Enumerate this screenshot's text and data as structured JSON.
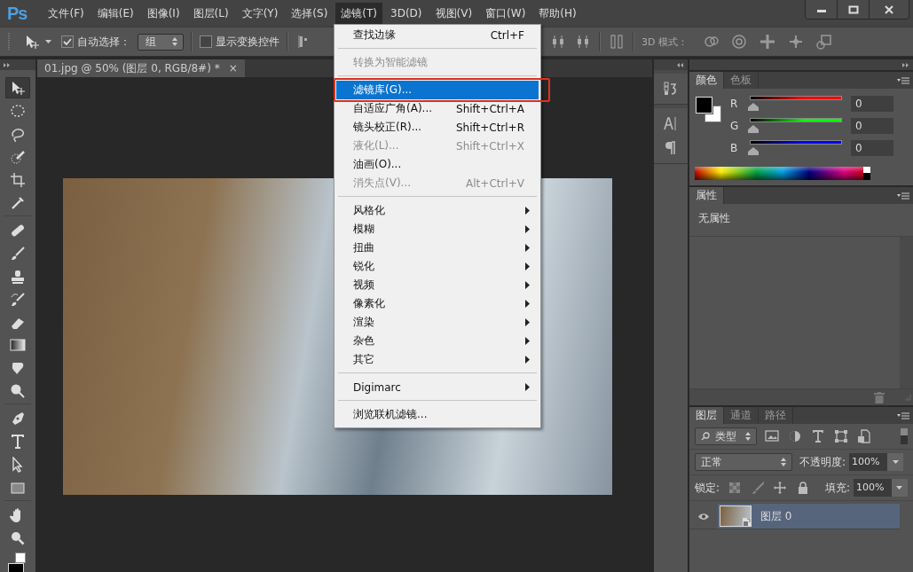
{
  "app_logo": "Ps",
  "menubar": [
    {
      "label": "文件(F)",
      "selected": false
    },
    {
      "label": "编辑(E)",
      "selected": false
    },
    {
      "label": "图像(I)",
      "selected": false
    },
    {
      "label": "图层(L)",
      "selected": false
    },
    {
      "label": "文字(Y)",
      "selected": false
    },
    {
      "label": "选择(S)",
      "selected": false
    },
    {
      "label": "滤镜(T)",
      "selected": true
    },
    {
      "label": "3D(D)",
      "selected": false
    },
    {
      "label": "视图(V)",
      "selected": false
    },
    {
      "label": "窗口(W)",
      "selected": false
    },
    {
      "label": "帮助(H)",
      "selected": false
    }
  ],
  "options_bar": {
    "auto_select": {
      "label": "自动选择：",
      "checked": true
    },
    "auto_select_target": "组",
    "show_transform": {
      "label": "显示变换控件",
      "checked": false
    },
    "mode_label": "3D 模式："
  },
  "document_tab": {
    "title": "01.jpg @ 50% (图层 0, RGB/8#) *",
    "close": "×"
  },
  "tools": [
    {
      "kind": "move",
      "selected": true
    },
    {
      "kind": "marquee",
      "selected": false
    },
    {
      "kind": "lasso",
      "selected": false
    },
    {
      "kind": "quick",
      "selected": false
    },
    {
      "kind": "crop",
      "selected": false
    },
    {
      "kind": "eyedropper",
      "selected": false
    },
    {
      "kind": "sep"
    },
    {
      "kind": "healing",
      "selected": false
    },
    {
      "kind": "brush",
      "selected": false
    },
    {
      "kind": "stamp",
      "selected": false
    },
    {
      "kind": "history",
      "selected": false
    },
    {
      "kind": "eraser",
      "selected": false
    },
    {
      "kind": "gradient",
      "selected": false
    },
    {
      "kind": "blur",
      "selected": false
    },
    {
      "kind": "dodge",
      "selected": false
    },
    {
      "kind": "sep"
    },
    {
      "kind": "pen",
      "selected": false
    },
    {
      "kind": "type",
      "selected": false
    },
    {
      "kind": "path",
      "selected": false
    },
    {
      "kind": "shape",
      "selected": false
    },
    {
      "kind": "sep"
    },
    {
      "kind": "hand",
      "selected": false
    },
    {
      "kind": "zoom",
      "selected": false
    }
  ],
  "filter_menu": [
    {
      "kind": "item",
      "label": "查找边缘",
      "shortcut": "Ctrl+F",
      "disabled": false,
      "selected": false
    },
    {
      "kind": "separator"
    },
    {
      "kind": "item",
      "label": "转换为智能滤镜",
      "disabled": true,
      "selected": false
    },
    {
      "kind": "separator"
    },
    {
      "kind": "item",
      "label": "滤镜库(G)...",
      "disabled": false,
      "selected": true,
      "outlined": true
    },
    {
      "kind": "item",
      "label": "自适应广角(A)...",
      "shortcut": "Shift+Ctrl+A",
      "disabled": false,
      "selected": false
    },
    {
      "kind": "item",
      "label": "镜头校正(R)...",
      "shortcut": "Shift+Ctrl+R",
      "disabled": false,
      "selected": false
    },
    {
      "kind": "item",
      "label": "液化(L)...",
      "shortcut": "Shift+Ctrl+X",
      "disabled": true,
      "selected": false
    },
    {
      "kind": "item",
      "label": "油画(O)...",
      "disabled": false,
      "selected": false
    },
    {
      "kind": "item",
      "label": "消失点(V)...",
      "shortcut": "Alt+Ctrl+V",
      "disabled": true,
      "selected": false
    },
    {
      "kind": "separator"
    },
    {
      "kind": "item",
      "label": "风格化",
      "submenu": true,
      "disabled": false,
      "selected": false
    },
    {
      "kind": "item",
      "label": "模糊",
      "submenu": true,
      "disabled": false,
      "selected": false
    },
    {
      "kind": "item",
      "label": "扭曲",
      "submenu": true,
      "disabled": false,
      "selected": false
    },
    {
      "kind": "item",
      "label": "锐化",
      "submenu": true,
      "disabled": false,
      "selected": false
    },
    {
      "kind": "item",
      "label": "视频",
      "submenu": true,
      "disabled": false,
      "selected": false
    },
    {
      "kind": "item",
      "label": "像素化",
      "submenu": true,
      "disabled": false,
      "selected": false
    },
    {
      "kind": "item",
      "label": "渲染",
      "submenu": true,
      "disabled": false,
      "selected": false
    },
    {
      "kind": "item",
      "label": "杂色",
      "submenu": true,
      "disabled": false,
      "selected": false
    },
    {
      "kind": "item",
      "label": "其它",
      "submenu": true,
      "disabled": false,
      "selected": false
    },
    {
      "kind": "separator"
    },
    {
      "kind": "item",
      "label": "Digimarc",
      "submenu": true,
      "disabled": false,
      "selected": false
    },
    {
      "kind": "separator"
    },
    {
      "kind": "item",
      "label": "浏览联机滤镜...",
      "disabled": false,
      "selected": false
    }
  ],
  "color_panel": {
    "tabs": [
      {
        "label": "颜色",
        "selected": true
      },
      {
        "label": "色板",
        "selected": false
      }
    ],
    "channels": [
      {
        "label": "R",
        "color": "#ff0000",
        "level": 0,
        "value": "0"
      },
      {
        "label": "G",
        "color": "#00ff00",
        "level": 0,
        "value": "0"
      },
      {
        "label": "B",
        "color": "#0000ff",
        "level": 0,
        "value": "0"
      }
    ]
  },
  "properties_panel": {
    "tabs": [
      {
        "label": "属性",
        "selected": true
      }
    ],
    "text": "无属性"
  },
  "layers_panel": {
    "tabs": [
      {
        "label": "图层",
        "selected": true
      },
      {
        "label": "通道",
        "selected": false
      },
      {
        "label": "路径",
        "selected": false
      }
    ],
    "filter": "类型",
    "blend_mode": "正常",
    "opacity_label": "不透明度:",
    "opacity": "100%",
    "lock_label": "锁定:",
    "fill_label": "填充:",
    "fill": "100%",
    "layers": [
      {
        "name": "图层 0",
        "visible": true,
        "selected": true
      }
    ]
  }
}
